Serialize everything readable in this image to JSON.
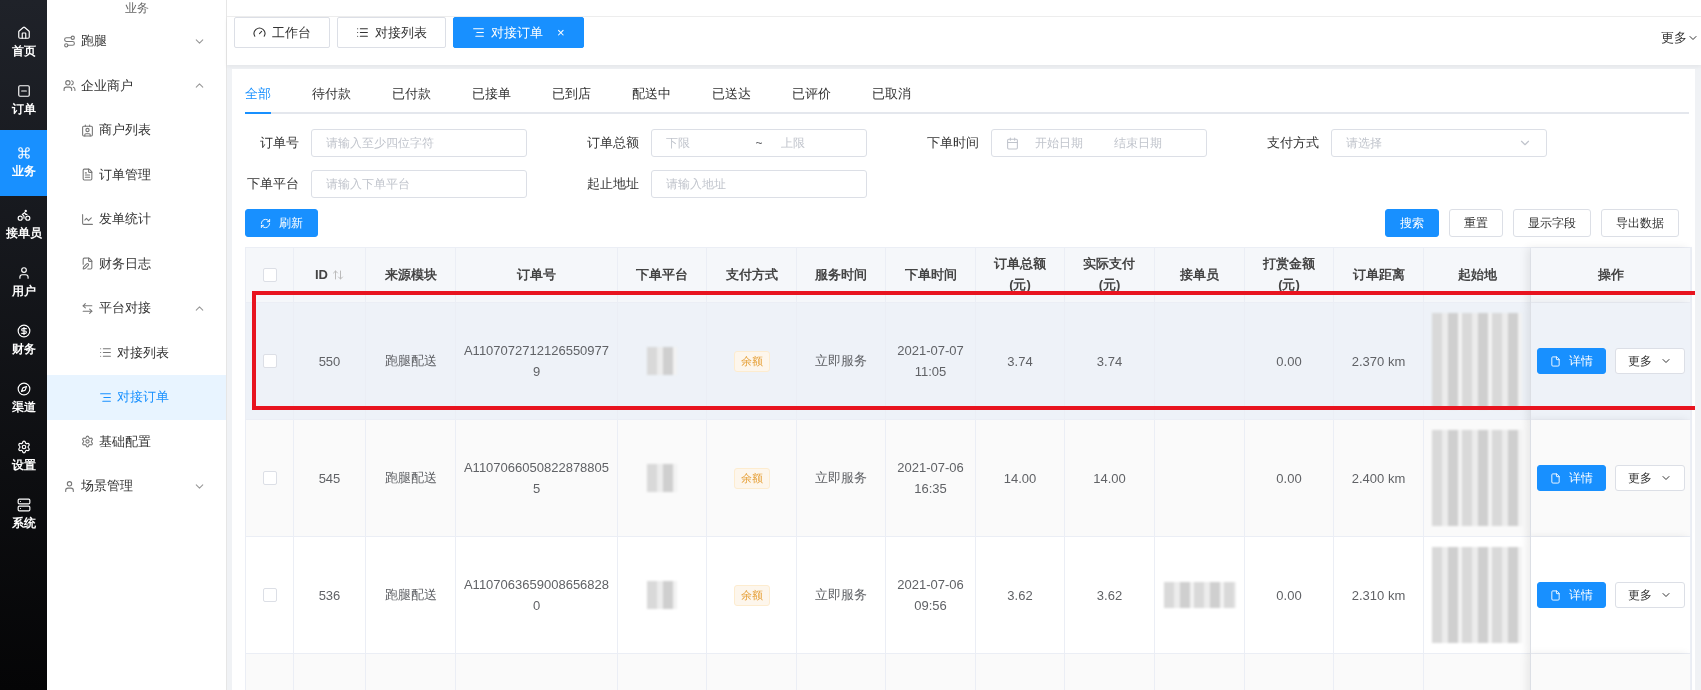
{
  "rail": [
    {
      "label": "首页",
      "selected": false
    },
    {
      "label": "订单",
      "selected": false
    },
    {
      "label": "业务",
      "selected": true
    },
    {
      "label": "接单员",
      "selected": false
    },
    {
      "label": "用户",
      "selected": false
    },
    {
      "label": "财务",
      "selected": false
    },
    {
      "label": "渠道",
      "selected": false
    },
    {
      "label": "设置",
      "selected": false
    },
    {
      "label": "系统",
      "selected": false
    }
  ],
  "menu": {
    "title": "业务",
    "items": [
      {
        "label": "跑腿",
        "expanded": false,
        "selected": false
      },
      {
        "label": "企业商户",
        "expanded": true,
        "selected": false,
        "children": [
          {
            "label": "商户列表",
            "selected": false
          },
          {
            "label": "订单管理",
            "selected": false
          },
          {
            "label": "发单统计",
            "selected": false
          },
          {
            "label": "财务日志",
            "selected": false
          },
          {
            "label": "平台对接",
            "expanded": true,
            "selected": false,
            "children": [
              {
                "label": "对接列表",
                "selected": false
              },
              {
                "label": "对接订单",
                "selected": true
              }
            ]
          },
          {
            "label": "基础配置",
            "selected": false
          }
        ]
      },
      {
        "label": "场景管理",
        "expanded": false,
        "selected": false
      }
    ]
  },
  "page_tabs": [
    {
      "label": "工作台",
      "selected": false,
      "closable": false
    },
    {
      "label": "对接列表",
      "selected": false,
      "closable": false
    },
    {
      "label": "对接订单",
      "selected": true,
      "closable": true
    }
  ],
  "close_glyph": "×",
  "more_label": "更多",
  "status_tabs": [
    {
      "label": "全部",
      "selected": true
    },
    {
      "label": "待付款",
      "selected": false
    },
    {
      "label": "已付款",
      "selected": false
    },
    {
      "label": "已接单",
      "selected": false
    },
    {
      "label": "已到店",
      "selected": false
    },
    {
      "label": "配送中",
      "selected": false
    },
    {
      "label": "已送达",
      "selected": false
    },
    {
      "label": "已评价",
      "selected": false
    },
    {
      "label": "已取消",
      "selected": false
    }
  ],
  "filters": [
    {
      "kind": "text",
      "label": "订单号",
      "placeholder": "请输入至少四位字符"
    },
    {
      "kind": "range",
      "label": "订单总额",
      "from_placeholder": "下限",
      "separator": "~",
      "to_placeholder": "上限"
    },
    {
      "kind": "date_range",
      "label": "下单时间",
      "from_placeholder": "开始日期",
      "to_placeholder": "结束日期"
    },
    {
      "kind": "select",
      "label": "支付方式",
      "placeholder": "请选择"
    },
    {
      "kind": "text",
      "label": "下单平台",
      "placeholder": "请输入下单平台"
    },
    {
      "kind": "text",
      "label": "起止地址",
      "placeholder": "请输入地址"
    }
  ],
  "refresh_button": "刷新",
  "actions": [
    {
      "label": "搜索",
      "primary": true
    },
    {
      "label": "重置",
      "primary": false
    },
    {
      "label": "显示字段",
      "primary": false
    },
    {
      "label": "导出数据",
      "primary": false
    }
  ],
  "table": {
    "all_checked": false,
    "columns": [
      {
        "label": "ID",
        "sortable": true
      },
      {
        "label": "来源模块",
        "sortable": false
      },
      {
        "label": "订单号",
        "sortable": false
      },
      {
        "label": "下单平台",
        "sortable": false
      },
      {
        "label": "支付方式",
        "sortable": false
      },
      {
        "label": "服务时间",
        "sortable": false
      },
      {
        "label": "下单时间",
        "sortable": false
      },
      {
        "label": "订单总额(元)",
        "sortable": false
      },
      {
        "label": "实际支付(元)",
        "sortable": false
      },
      {
        "label": "接单员",
        "sortable": false
      },
      {
        "label": "打赏金额(元)",
        "sortable": false
      },
      {
        "label": "订单距离",
        "sortable": false
      },
      {
        "label": "起始地",
        "sortable": false
      },
      {
        "label": "操作",
        "sortable": false
      }
    ],
    "rows": [
      {
        "checked": false,
        "hovered": true,
        "annotated": true,
        "id": "550",
        "source": "跑腿配送",
        "order_no": "A11070727121265509779",
        "platform_redacted": true,
        "pay": "余额",
        "service": "立即服务",
        "time": "2021-07-07 11:05",
        "total": "3.74",
        "paid": "3.74",
        "courier_redacted": false,
        "tip": "0.00",
        "distance": "2.370 km",
        "address_redacted": true,
        "detail": "详情",
        "more": "更多"
      },
      {
        "checked": false,
        "hovered": false,
        "annotated": false,
        "id": "545",
        "source": "跑腿配送",
        "order_no": "A11070660508228788055",
        "platform_redacted": true,
        "pay": "余额",
        "service": "立即服务",
        "time": "2021-07-06 16:35",
        "total": "14.00",
        "paid": "14.00",
        "courier_redacted": false,
        "tip": "0.00",
        "distance": "2.400 km",
        "address_redacted": true,
        "detail": "详情",
        "more": "更多"
      },
      {
        "checked": false,
        "hovered": false,
        "annotated": false,
        "id": "536",
        "source": "跑腿配送",
        "order_no": "A11070636590086568280",
        "platform_redacted": true,
        "pay": "余额",
        "service": "立即服务",
        "time": "2021-07-06 09:56",
        "total": "3.62",
        "paid": "3.62",
        "courier_redacted": true,
        "tip": "0.00",
        "distance": "2.310 km",
        "address_redacted": true,
        "detail": "详情",
        "more": "更多"
      }
    ]
  }
}
